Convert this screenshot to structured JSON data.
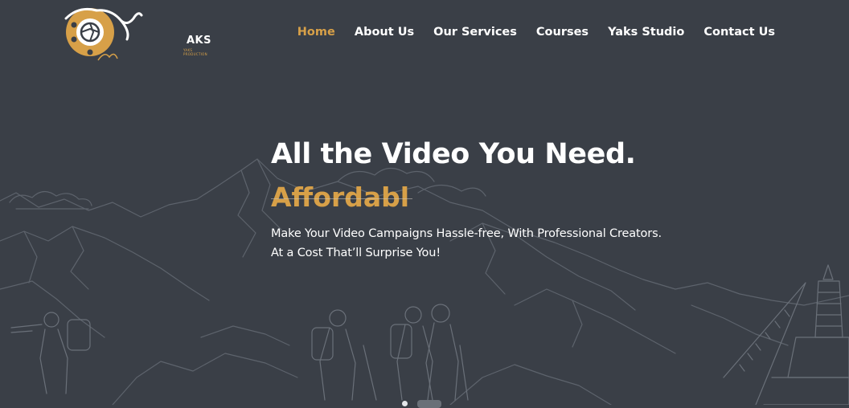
{
  "brand": {
    "logo_text": "AKS",
    "logo_subtext": "YAKS PRODUCTION",
    "accent_color": "#d7a048",
    "background_color": "#3a3f47"
  },
  "nav": {
    "items": [
      {
        "label": "Home",
        "active": true
      },
      {
        "label": "About Us",
        "active": false
      },
      {
        "label": "Our Services",
        "active": false
      },
      {
        "label": "Courses",
        "active": false
      },
      {
        "label": "Yaks Studio",
        "active": false
      },
      {
        "label": "Contact Us",
        "active": false
      }
    ]
  },
  "hero": {
    "title": "All the Video You Need.",
    "typed_text": "Affordabl",
    "description": "Make Your Video Campaigns Hassle-free, With Professional Creators. At a Cost That’ll Surprise You!",
    "background_icon": "mountain-trekkers-illustration"
  },
  "slider": {
    "slide_count": 2,
    "active_index": 1
  }
}
